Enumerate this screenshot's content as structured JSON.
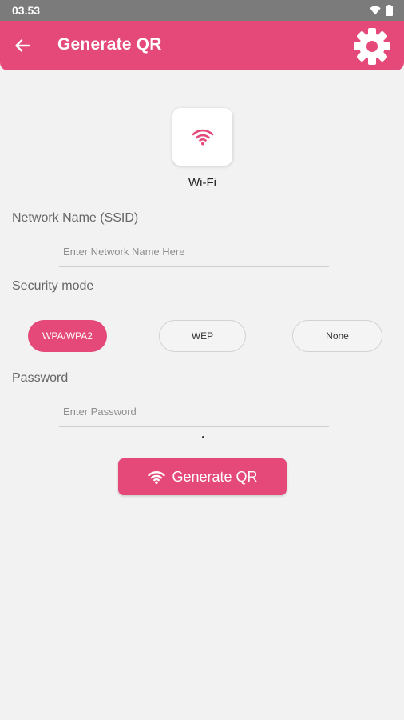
{
  "status_bar": {
    "time": "03.53",
    "icons": [
      "wifi-icon",
      "battery-icon"
    ]
  },
  "app_bar": {
    "title": "Generate QR",
    "back_icon": "arrow-left-icon",
    "settings_icon": "gear-icon"
  },
  "qr_type": {
    "icon": "wifi-icon",
    "label": "Wi-Fi"
  },
  "network_name": {
    "label": "Network Name (SSID)",
    "value": "",
    "placeholder": "Enter Network Name Here"
  },
  "security": {
    "label": "Security mode",
    "options": [
      {
        "label": "WPA/WPA2",
        "selected": true
      },
      {
        "label": "WEP",
        "selected": false
      },
      {
        "label": "None",
        "selected": false
      }
    ]
  },
  "password": {
    "label": "Password",
    "value": "",
    "placeholder": "Enter Password"
  },
  "generate_button": {
    "label": "Generate QR",
    "icon": "wifi-icon"
  },
  "colors": {
    "accent": "#e4497a",
    "background": "#f2f2f2",
    "status_bar": "#7b7b7b"
  }
}
